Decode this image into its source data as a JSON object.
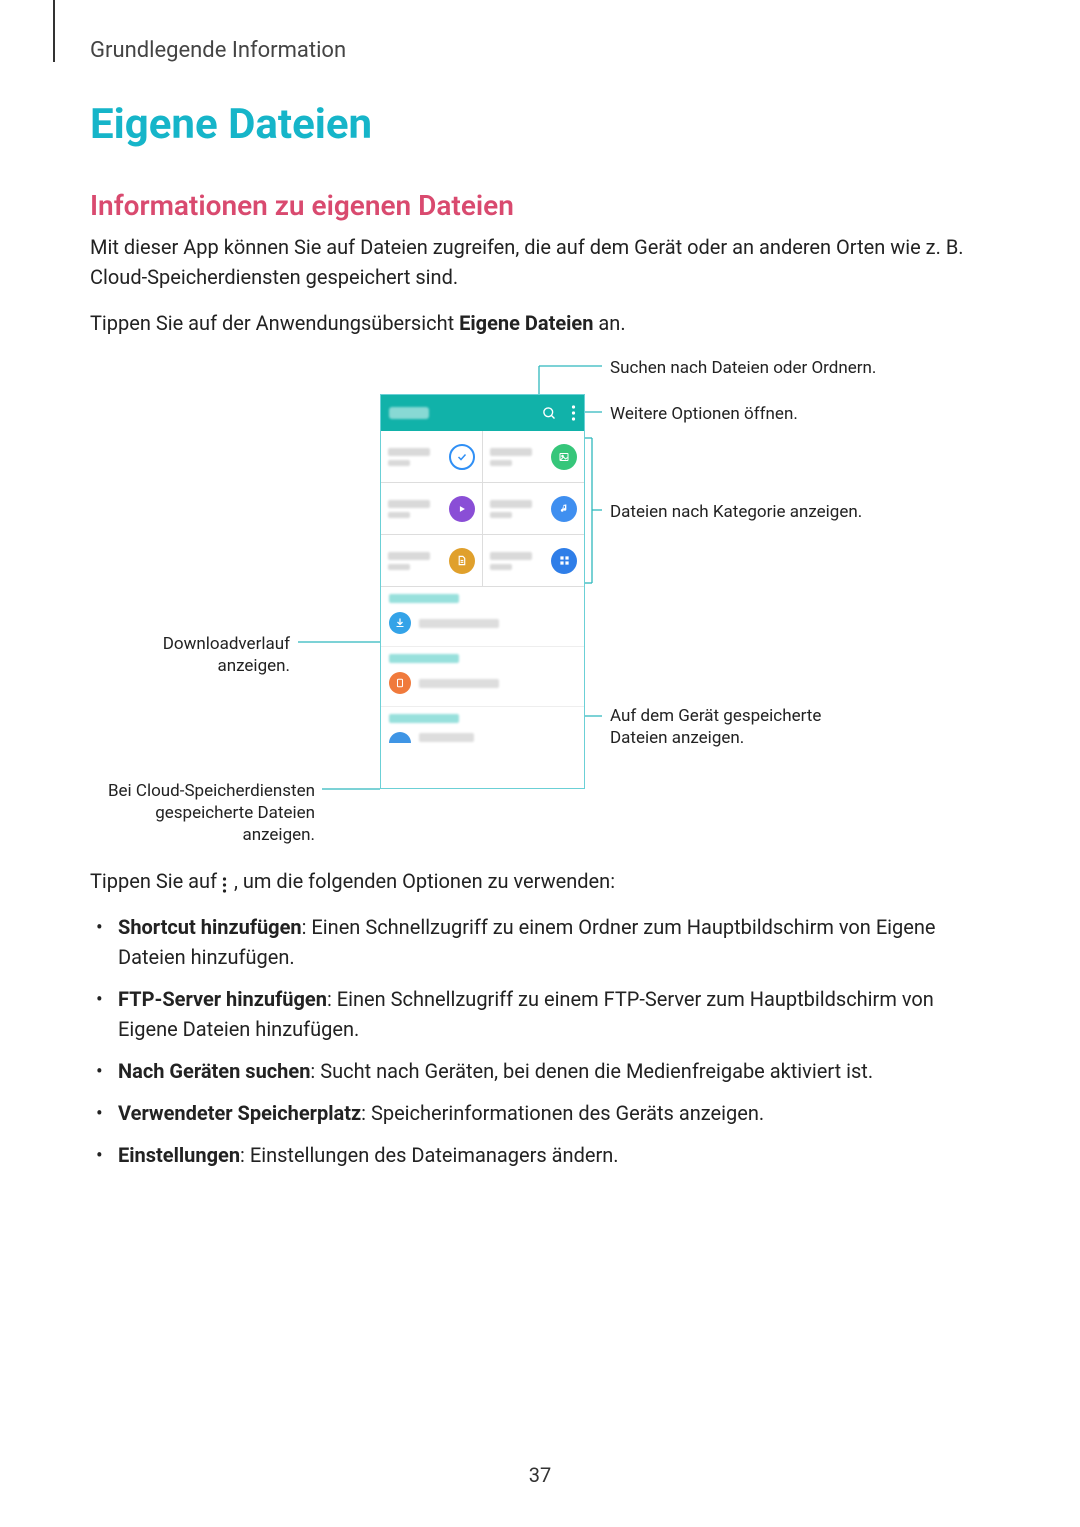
{
  "header": {
    "section": "Grundlegende Information"
  },
  "title": "Eigene Dateien",
  "subtitle": "Informationen zu eigenen Dateien",
  "intro1": "Mit dieser App können Sie auf Dateien zugreifen, die auf dem Gerät oder an anderen Orten wie z. B. Cloud-Speicherdiensten gespeichert sind.",
  "intro2_a": "Tippen Sie auf der Anwendungsübersicht ",
  "intro2_b": "Eigene Dateien",
  "intro2_c": " an.",
  "callouts": {
    "search": "Suchen nach Dateien oder Ordnern.",
    "more": "Weitere Optionen öffnen.",
    "category": "Dateien nach Kategorie anzeigen.",
    "device": "Auf dem Gerät gespeicherte Dateien anzeigen.",
    "download": "Downloadverlauf anzeigen.",
    "cloud": "Bei Cloud-Speicherdiensten gespeicherte Dateien anzeigen."
  },
  "after_img_a": "Tippen Sie auf ",
  "after_img_b": ", um die folgenden Optionen zu verwenden:",
  "options": [
    {
      "name": "Shortcut hinzufügen",
      "desc": ": Einen Schnellzugriff zu einem Ordner zum Hauptbildschirm von Eigene Dateien hinzufügen."
    },
    {
      "name": "FTP-Server hinzufügen",
      "desc": ": Einen Schnellzugriff zu einem FTP-Server zum Hauptbildschirm von Eigene Dateien hinzufügen."
    },
    {
      "name": "Nach Geräten suchen",
      "desc": ": Sucht nach Geräten, bei denen die Medienfreigabe aktiviert ist."
    },
    {
      "name": "Verwendeter Speicherplatz",
      "desc": ": Speicherinformationen des Geräts anzeigen."
    },
    {
      "name": "Einstellungen",
      "desc": ": Einstellungen des Dateimanagers ändern."
    }
  ],
  "page": "37"
}
